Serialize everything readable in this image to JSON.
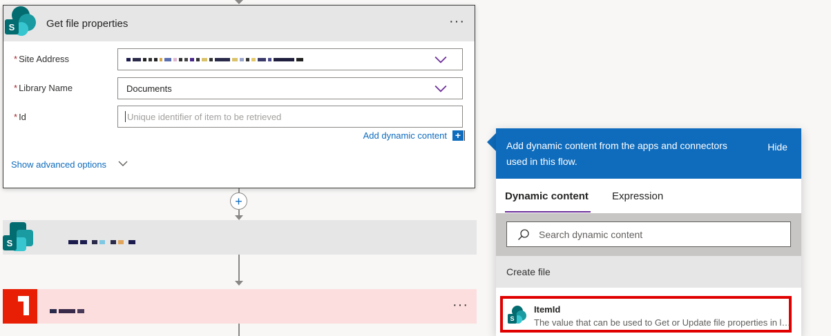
{
  "card": {
    "title": "Get file properties",
    "more_label": "···",
    "fields": {
      "site_address": {
        "required_mark": "*",
        "label": "Site Address"
      },
      "library_name": {
        "required_mark": "*",
        "label": "Library Name",
        "value": "Documents"
      },
      "id": {
        "required_mark": "*",
        "label": "Id",
        "placeholder": "Unique identifier of item to be retrieved"
      }
    },
    "add_dynamic_content": "Add dynamic content",
    "add_dynamic_icon": "+",
    "show_advanced_options": "Show advanced options"
  },
  "flow": {
    "add_step_label": "+",
    "step3_more_label": "···"
  },
  "panel": {
    "header_text": "Add dynamic content from the apps and connectors used in this flow.",
    "hide_label": "Hide",
    "tabs": [
      {
        "label": "Dynamic content",
        "selected": true
      },
      {
        "label": "Expression",
        "selected": false
      }
    ],
    "search_placeholder": "Search dynamic content",
    "section_title": "Create file",
    "item": {
      "title": "ItemId",
      "description": "The value that can be used to Get or Update file properties in libraries."
    }
  },
  "colors": {
    "accent": "#0f6cbd",
    "tab_underline": "#6b2d99",
    "highlight": "#e00000",
    "required": "#a4262c",
    "error_step": "#fddede",
    "error_icon": "#e81e05"
  },
  "icons": {
    "card_icon": "sharepoint-icon",
    "step2_icon": "sharepoint-icon",
    "step3_icon": "office-icon",
    "dropdown": "chevron-down-icon",
    "search": "search-icon"
  }
}
